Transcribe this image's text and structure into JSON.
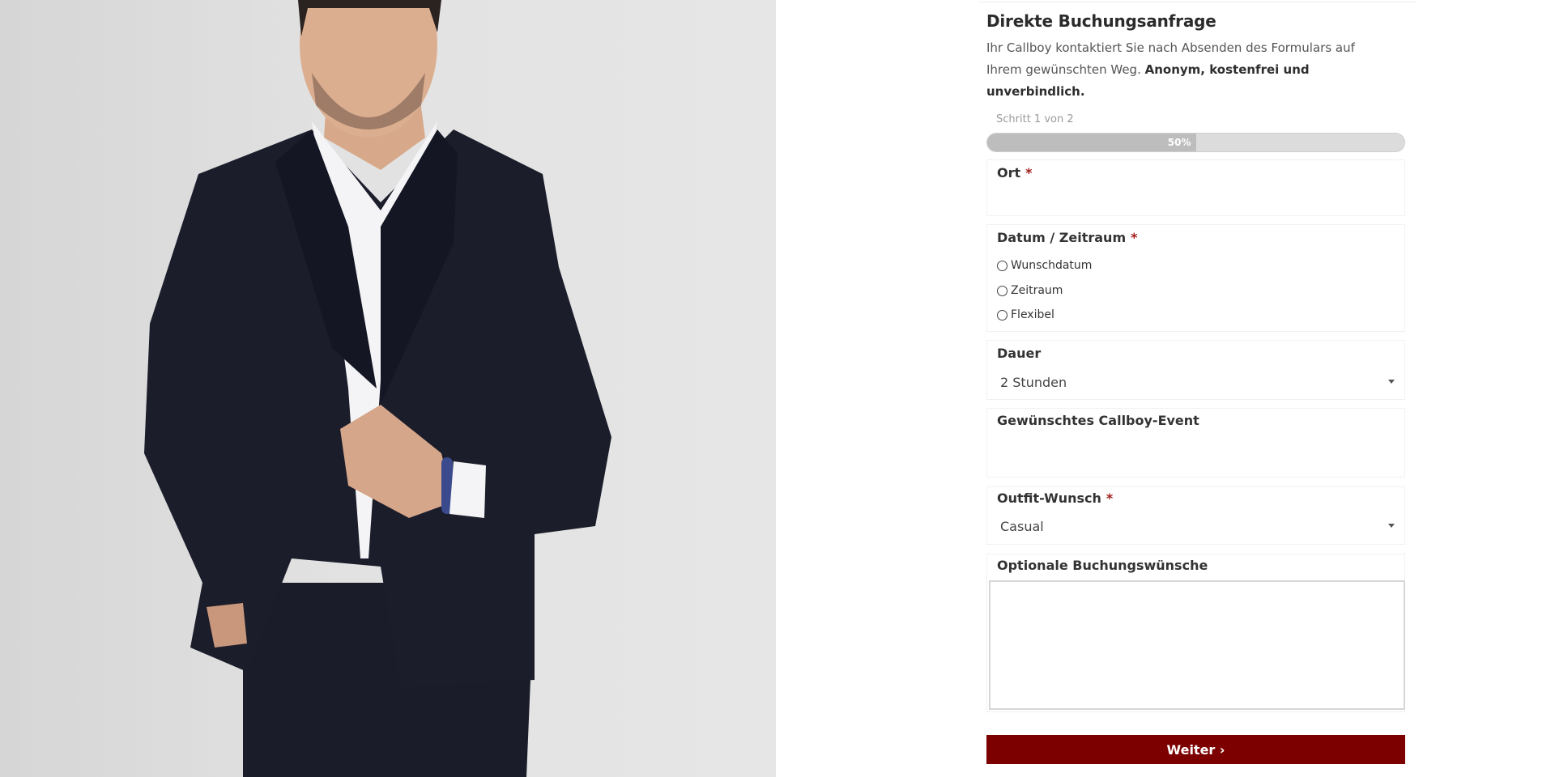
{
  "photo": {
    "description_icon": "man-in-dark-suit-photo"
  },
  "form": {
    "title": "Direkte Buchungsanfrage",
    "intro_text": "Ihr Callboy kontaktiert Sie nach Absenden des Formulars auf Ihrem gewünschten Weg.",
    "intro_bold": "Anonym, kostenfrei und unverbindlich.",
    "step_label": "Schritt 1 von 2",
    "progress": {
      "percent": 50,
      "label": "50%"
    },
    "required_mark": "*",
    "fields": {
      "ort": {
        "label": "Ort"
      },
      "datum": {
        "label": "Datum / Zeitraum",
        "options": [
          "Wunschdatum",
          "Zeitraum",
          "Flexibel"
        ]
      },
      "dauer": {
        "label": "Dauer",
        "value": "2 Stunden"
      },
      "event": {
        "label": "Gewünschtes Callboy-Event"
      },
      "outfit": {
        "label": "Outfit-Wunsch",
        "value": "Casual"
      },
      "wuensche": {
        "label": "Optionale Buchungswünsche"
      }
    },
    "submit_label": "Weiter ›"
  },
  "colors": {
    "accent": "#7d0000",
    "required": "#a11d1d",
    "progress_track": "#dcdcdc",
    "progress_fill": "#bdbdbd"
  }
}
